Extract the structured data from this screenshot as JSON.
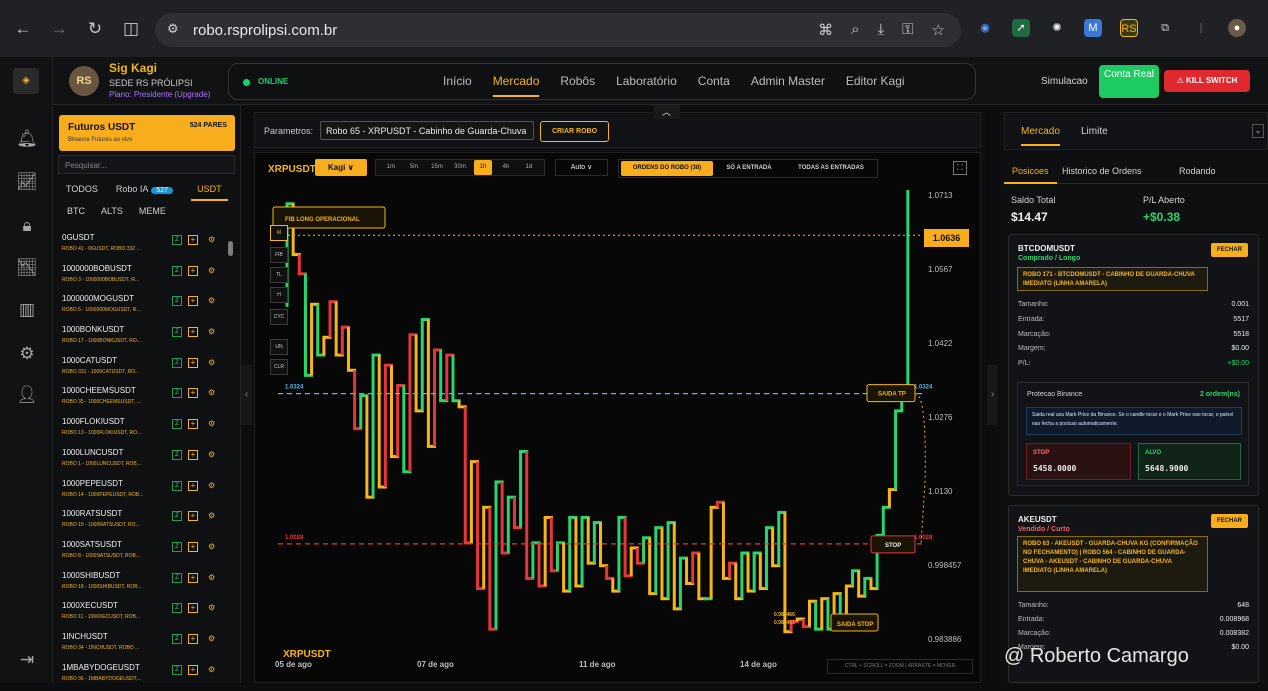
{
  "browser": {
    "url": "robo.rsprolipsi.com.br"
  },
  "brand": {
    "name": "Sig Kagi",
    "subtitle": "SEDE RS PRÓLIPSI",
    "plan": "Plano: Presidente (Upgrade)",
    "logo_text": "RS"
  },
  "status": {
    "label": "ONLINE"
  },
  "nav": {
    "items": [
      {
        "label": "Início",
        "active": false
      },
      {
        "label": "Mercado",
        "active": true
      },
      {
        "label": "Robôs",
        "active": false
      },
      {
        "label": "Laboratório",
        "active": false
      },
      {
        "label": "Conta",
        "active": false
      },
      {
        "label": "Admin Master",
        "active": false
      },
      {
        "label": "Editor Kagi",
        "active": false
      }
    ],
    "simulacao": "Simulacao",
    "conta_real": "Conta Real",
    "kill_switch": "⚠ KILL SWITCH"
  },
  "sidebar": {
    "card_title": "Futuros USDT",
    "card_sub": "Binance Futures ao vivo",
    "card_count": "524 PARES",
    "search_placeholder": "Pesquisar...",
    "tabs": [
      {
        "label": "TODOS",
        "active": false
      },
      {
        "label": "Robo IA",
        "badge": "527",
        "active": false
      },
      {
        "label": "USDT",
        "active": true
      }
    ],
    "subtabs": [
      "BTC",
      "ALTS",
      "MEME"
    ],
    "pairs": [
      {
        "name": "0GUSDT",
        "desc": "ROBO 41 - 0GUSDT, ROBO 332 ..."
      },
      {
        "name": "1000000BOBUSDT",
        "desc": "ROBO 3 - 1000000BOBUSDT, R..."
      },
      {
        "name": "1000000MOGUSDT",
        "desc": "ROBO 5 - 1000000MOGUSDT, R..."
      },
      {
        "name": "1000BONKUSDT",
        "desc": "ROBO 17 - 1000BONKUSDT, RO..."
      },
      {
        "name": "1000CATUSDT",
        "desc": "ROBO 331 - 1000CATUSDT, RO..."
      },
      {
        "name": "1000CHEEMSUSDT",
        "desc": "ROBO 35 - 1000CHEEMSUSDT, ..."
      },
      {
        "name": "1000FLOKIUSDT",
        "desc": "ROBO 13 - 1000FLOKIUSDT, RO..."
      },
      {
        "name": "1000LUNCUSDT",
        "desc": "ROBO 1 - 1000LUNCUSDT, ROB..."
      },
      {
        "name": "1000PEPEUSDT",
        "desc": "ROBO 14 - 1000PEPEUSDT, ROB..."
      },
      {
        "name": "1000RATSUSDT",
        "desc": "ROBO 15 - 1000RATSUSDT, RO..."
      },
      {
        "name": "1000SATSUSDT",
        "desc": "ROBO 8 - 1000SATSUSDT, ROB..."
      },
      {
        "name": "1000SHIBUSDT",
        "desc": "ROBO 18 - 1000SHIBUSDT, ROB..."
      },
      {
        "name": "1000XECUSDT",
        "desc": "ROBO 11 - 1000XECUSDT, ROB..."
      },
      {
        "name": "1INCHUSDT",
        "desc": "ROBO 34 - 1INCHUSDT, ROBO ..."
      },
      {
        "name": "1MBABYDOGEUSDT",
        "desc": "ROBO 36 - 1MBABYDOGEUSDT,..."
      }
    ]
  },
  "params": {
    "label": "Parametros:",
    "selected": "Robo 65 - XRPUSDT - Cabinho de Guarda-Chuva",
    "create": "CRIAR ROBO"
  },
  "chart_toolbar": {
    "symbol": "XRPUSDT",
    "type": "Kagi ∨",
    "timeframes": [
      {
        "label": "1m",
        "active": false
      },
      {
        "label": "5m",
        "active": false
      },
      {
        "label": "15m",
        "active": false
      },
      {
        "label": "30m",
        "active": false
      },
      {
        "label": "1h",
        "active": true
      },
      {
        "label": "4h",
        "active": false
      },
      {
        "label": "1d",
        "active": false
      }
    ],
    "auto": "Auto ∨",
    "order_filters": [
      {
        "label": "ORDENS DO ROBO (38)",
        "active": true
      },
      {
        "label": "SÓ A ENTRADA",
        "active": false
      },
      {
        "label": "TODAS AS ENTRADAS",
        "active": false
      }
    ],
    "fullscreen": "⛶"
  },
  "drawing_tools": [
    {
      "label": "M",
      "active": true
    },
    {
      "label": "FIB",
      "active": false
    },
    {
      "label": "TL",
      "active": false
    },
    {
      "label": "H",
      "active": false
    },
    {
      "label": "CYC",
      "active": false
    },
    {
      "label": "UN",
      "active": false
    },
    {
      "label": "CLR",
      "active": false
    }
  ],
  "chart_data": {
    "type": "line",
    "style": "kagi",
    "symbol": "XRPUSDT",
    "timeframe": "1h",
    "y_axis_ticks": [
      "1.0713",
      "1.0567",
      "1.0422",
      "1.0276",
      "1.0130",
      "0.998457",
      "0.983886"
    ],
    "x_axis_ticks": [
      "05 de ago",
      "07 de ago",
      "11 de ago",
      "14 de ago"
    ],
    "current_price": "1.0636",
    "ylim": [
      0.9815,
      1.0735
    ],
    "kagi_prices": [
      1.0495,
      1.0698,
      1.0598,
      1.056,
      1.036,
      1.05,
      1.04,
      1.0435,
      1.0505,
      1.04,
      1.0455,
      1.037,
      1.0255,
      1.032,
      1.012,
      1.04,
      1.014,
      1.038,
      1.02,
      1.034,
      1.017,
      1.044,
      1.029,
      1.047,
      1.022,
      1.041,
      1.031,
      1.04,
      1.031,
      1.0298,
      1.003,
      1.019,
      0.994,
      1.01,
      0.986,
      1.015,
      1.001,
      1.012,
      1.006,
      1.021,
      0.996,
      1.003,
      0.9945,
      1.008,
      0.9975,
      1.003,
      0.9935,
      1.008,
      0.9945,
      1.008,
      0.999,
      1.007,
      0.9985,
      0.996,
      0.9935,
      1.008,
      0.9965,
      1.002,
      0.999,
      1.004,
      0.993,
      1.006,
      0.992,
      1.007,
      0.99,
      1.0,
      0.995,
      1.001,
      0.992,
      0.992,
      1.01,
      1.011,
      0.996,
      0.999,
      0.992,
      1.001,
      0.9935,
      1.001,
      0.994,
      1.006,
      0.9985,
      1.009,
      0.9855,
      0.9875,
      0.988,
      0.9865,
      0.9915,
      0.986,
      0.992,
      0.986,
      0.993,
      0.986,
      0.9945,
      0.9975,
      0.9925,
      0.996,
      0.994,
      1.0045,
      1.01,
      1.0135,
      1.029,
      1.0315,
      1.0725
    ],
    "kagi_colors": [
      "yellow",
      "green",
      "yellow",
      "red",
      "green",
      "yellow",
      "green",
      "yellow",
      "red",
      "yellow",
      "red",
      "yellow",
      "red",
      "green",
      "yellow",
      "green",
      "yellow",
      "red",
      "yellow",
      "red",
      "green",
      "red",
      "yellow",
      "green",
      "yellow",
      "red",
      "green",
      "red",
      "green",
      "yellow",
      "red",
      "yellow",
      "red",
      "yellow",
      "red",
      "green",
      "red",
      "green",
      "red",
      "green",
      "red",
      "green",
      "red",
      "yellow",
      "red",
      "green",
      "yellow",
      "green",
      "yellow",
      "green",
      "yellow",
      "green",
      "yellow",
      "red",
      "yellow",
      "green",
      "red",
      "yellow",
      "red",
      "green",
      "yellow",
      "green",
      "yellow",
      "green",
      "yellow",
      "green",
      "yellow",
      "red",
      "yellow",
      "green",
      "yellow",
      "red",
      "yellow",
      "red",
      "yellow",
      "green",
      "yellow",
      "green",
      "yellow",
      "green",
      "yellow",
      "green",
      "yellow",
      "red",
      "yellow",
      "red",
      "yellow",
      "green",
      "yellow",
      "green",
      "yellow",
      "green",
      "yellow",
      "green",
      "yellow",
      "green",
      "yellow",
      "green",
      "green",
      "yellow",
      "green",
      "green",
      "green"
    ],
    "annotations": [
      {
        "label": "FIB LONG OPERACIONAL",
        "color": "#f7b518"
      },
      {
        "label": "1.0324",
        "price": 1.0324,
        "line": "dashed",
        "color": "#5ab4e6"
      },
      {
        "label": "SAIDA TP",
        "price": 1.0324,
        "color": "#f7b518"
      },
      {
        "label": "1.0028",
        "price": 1.0028,
        "line": "dashed",
        "color": "#e6363a"
      },
      {
        "label": "STOP",
        "price": 1.0028,
        "color": "#e6363a"
      },
      {
        "label": "SAIDA STOP",
        "color": "#f7b518"
      },
      {
        "label": "0.986466",
        "color": "#f7b518"
      },
      {
        "label": "0.986451",
        "color": "#f7b518"
      }
    ]
  },
  "chart_footer": {
    "symbol": "XRPUSDT",
    "hint": "CTRL + SCROLL = ZOOM | ARRASTE = MOVER"
  },
  "right_panel": {
    "tabs": [
      {
        "label": "Mercado",
        "active": true
      },
      {
        "label": "Limite",
        "active": false
      }
    ],
    "pos_tabs": [
      {
        "label": "Posicoes",
        "active": true
      },
      {
        "label": "Historico de Ordens",
        "active": false
      },
      {
        "label": "Rodando",
        "active": false
      }
    ],
    "saldo_label": "Saldo Total",
    "saldo_value": "$14.47",
    "pl_label": "P/L Aberto",
    "pl_value": "+$0.38",
    "positions": [
      {
        "symbol": "BTCDOMUSDT",
        "side": "Comprado / Longo",
        "close": "FECHAR",
        "robo": "ROBO 171 - BTCDOMUSDT - CABINHO DE GUARDA-CHUVA IMEDIATO (LINHA AMARELA)",
        "rows": [
          {
            "k": "Tamanho:",
            "v": "0.001"
          },
          {
            "k": "Entrada:",
            "v": "5517"
          },
          {
            "k": "Marcação:",
            "v": "5518"
          },
          {
            "k": "Margem:",
            "v": "$0.00"
          },
          {
            "k": "P/L:",
            "v": "+$0.00"
          }
        ],
        "protect_title": "Protecao Binance",
        "protect_count": "2 ordem(ns)",
        "protect_info": "Saida real usa Mark Price da Binance. Se o candle tocar e o Mark Price nao tocar, o painel nao fecha a posicao automaticamente.",
        "stop_label": "STOP",
        "stop_value": "5458.0000",
        "alvo_label": "ALVO",
        "alvo_value": "5648.9000"
      },
      {
        "symbol": "AKEUSDT",
        "side": "Vendido / Curto",
        "close": "FECHAR",
        "robo": "ROBO 63 - AKEUSDT - GUARDA-CHUVA KG (CONFIRMAÇÃO NO FECHAMENTO) | ROBO 564 - CABINHO DE GUARDA-CHUVA - AKEUSDT - CABINHO DE GUARDA-CHUVA IMEDIATO (LINHA AMARELA)",
        "rows": [
          {
            "k": "Tamanho:",
            "v": "648"
          },
          {
            "k": "Entrada:",
            "v": "0.008968"
          },
          {
            "k": "Marcação:",
            "v": "0.008382"
          },
          {
            "k": "Margem:",
            "v": "$0.00"
          }
        ]
      }
    ]
  },
  "watermark": "@ Roberto Camargo",
  "colors": {
    "accent": "#f7b518",
    "green": "#27d66d",
    "red": "#e6363a",
    "blue": "#5ab4e6"
  }
}
